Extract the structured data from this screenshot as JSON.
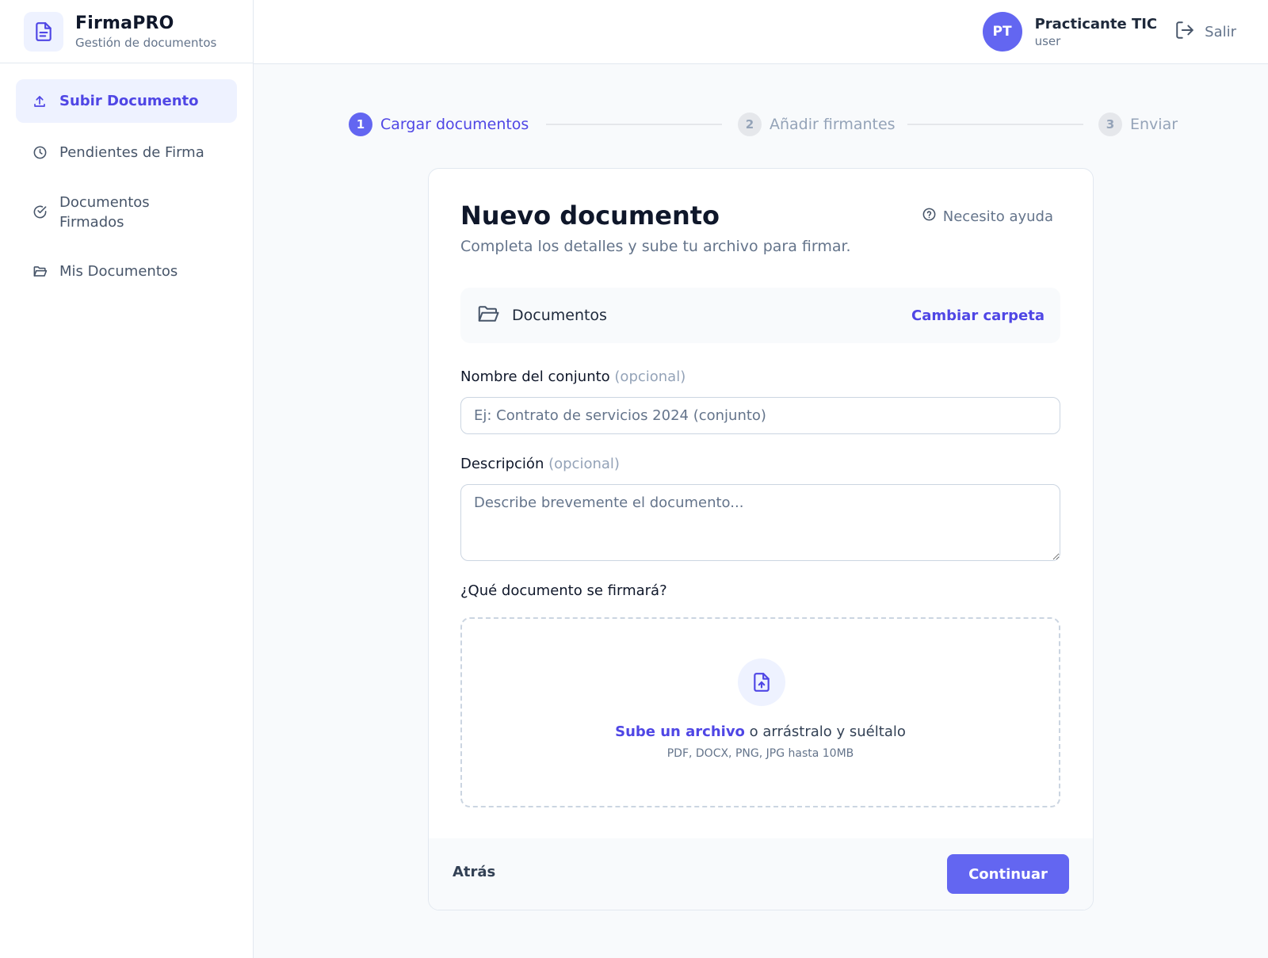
{
  "brand": {
    "title": "FirmaPRO",
    "subtitle": "Gestión de documentos"
  },
  "sidebar": {
    "items": [
      {
        "label": "Subir Documento",
        "icon": "upload-icon",
        "active": true
      },
      {
        "label": "Pendientes de Firma",
        "icon": "clock-icon",
        "active": false
      },
      {
        "label": "Documentos Firmados",
        "icon": "check-circle-icon",
        "active": false
      },
      {
        "label": "Mis Documentos",
        "icon": "folder-open-icon",
        "active": false
      }
    ]
  },
  "header": {
    "avatar_initials": "PT",
    "user_name": "Practicante TIC",
    "user_role": "user",
    "logout_label": "Salir"
  },
  "stepper": {
    "steps": [
      {
        "number": "1",
        "label": "Cargar documentos",
        "active": true
      },
      {
        "number": "2",
        "label": "Añadir firmantes",
        "active": false
      },
      {
        "number": "3",
        "label": "Enviar",
        "active": false
      }
    ]
  },
  "card": {
    "title": "Nuevo documento",
    "subtitle": "Completa los detalles y sube tu archivo para firmar.",
    "help_label": "Necesito ayuda",
    "folder": {
      "name": "Documentos",
      "change_label": "Cambiar carpeta"
    },
    "set_name": {
      "label": "Nombre del conjunto",
      "optional": "(opcional)",
      "value": "",
      "placeholder": "Ej: Contrato de servicios 2024 (conjunto)"
    },
    "description": {
      "label": "Descripción",
      "optional": "(opcional)",
      "value": "",
      "placeholder": "Describe brevemente el documento..."
    },
    "upload": {
      "label": "¿Qué documento se firmará?",
      "link_text": "Sube un archivo",
      "rest_text": " o arrástralo y suéltalo",
      "hint": "PDF, DOCX, PNG, JPG hasta 10MB"
    },
    "footer": {
      "back_label": "Atrás",
      "continue_label": "Continuar"
    }
  },
  "colors": {
    "accent": "#6366f1",
    "accent_text": "#4f46e5",
    "accent_soft": "#eef2ff",
    "muted": "#94a3b8"
  }
}
